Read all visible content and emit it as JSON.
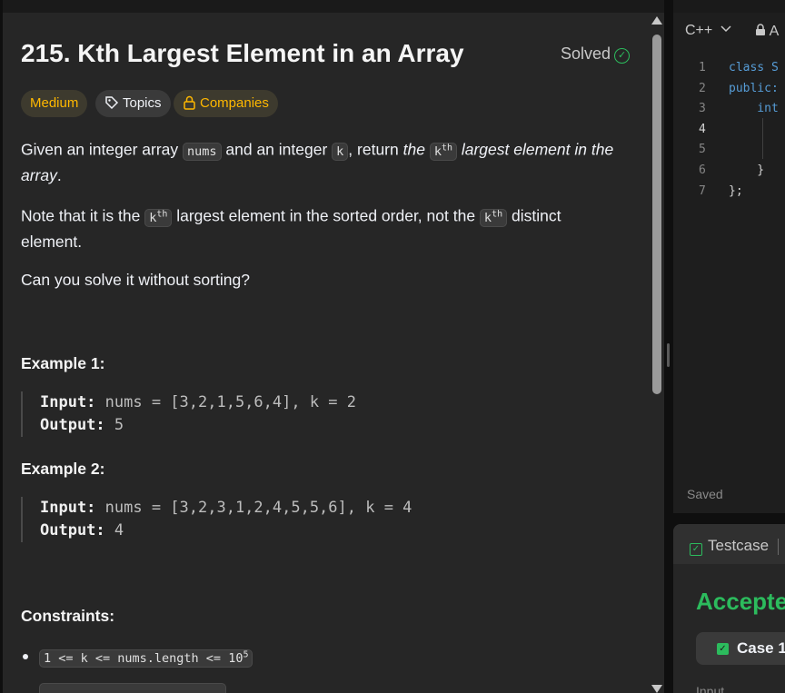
{
  "problem": {
    "title": "215. Kth Largest Element in an Array",
    "status": "Solved",
    "status_icon": "check-circle-icon",
    "difficulty": "Medium",
    "topics_label": "Topics",
    "companies_label": "Companies",
    "desc_1_a": "Given an integer array ",
    "desc_1_code_nums": "nums",
    "desc_1_b": " and an integer ",
    "desc_1_code_k": "k",
    "desc_1_c": ", return ",
    "desc_1_d_em": "the ",
    "desc_1_code_kth": "k",
    "desc_1_sup": "th",
    "desc_1_e_em": " largest element in the array",
    "desc_1_f": ".",
    "desc_2_a": "Note that it is the ",
    "desc_2_code_kth": "k",
    "desc_2_sup": "th",
    "desc_2_b": " largest element in the sorted order, not the ",
    "desc_2_code_kth2": "k",
    "desc_2_sup2": "th",
    "desc_2_c": " distinct element.",
    "desc_3": "Can you solve it without sorting?",
    "examples": [
      {
        "title": "Example 1:",
        "input_label": "Input:",
        "input_value": " nums = [3,2,1,5,6,4], k = 2",
        "output_label": "Output:",
        "output_value": " 5"
      },
      {
        "title": "Example 2:",
        "input_label": "Input:",
        "input_value": " nums = [3,2,3,1,2,4,5,5,6], k = 4",
        "output_label": "Output:",
        "output_value": " 4"
      }
    ],
    "constraints_title": "Constraints:",
    "constraint_1": "1 <= k <= nums.length <= 10",
    "constraint_1_sup": "5"
  },
  "editor": {
    "language": "C++",
    "lock_label": "A",
    "line_numbers": [
      "1",
      "2",
      "3",
      "4",
      "5",
      "6",
      "7"
    ],
    "lines": [
      "class S",
      "public:",
      "    int",
      "",
      "",
      "    }",
      "};"
    ],
    "saved_label": "Saved"
  },
  "testpanel": {
    "tab_label": "Testcase",
    "result": "Accepted",
    "case_label": "Case 1",
    "input_label": "Input"
  },
  "colors": {
    "accepted_green": "#2cbb5d",
    "medium_yellow": "#ffb800",
    "panel_bg": "#262626",
    "editor_bg": "#1e1e1e",
    "keyword_blue": "#569cd6"
  }
}
